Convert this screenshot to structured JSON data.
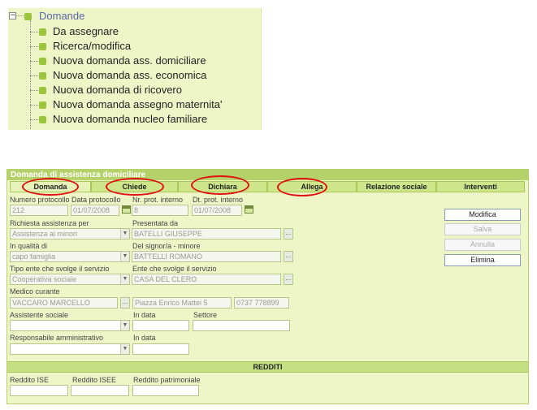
{
  "tree": {
    "toggle": "−",
    "root_label": "Domande",
    "items": [
      {
        "label": "Da assegnare"
      },
      {
        "label": "Ricerca/modifica"
      },
      {
        "label": "Nuova domanda ass. domiciliare"
      },
      {
        "label": "Nuova domanda ass. economica"
      },
      {
        "label": "Nuova domanda di ricovero"
      },
      {
        "label": "Nuova domanda assegno maternita'"
      },
      {
        "label": "Nuova domanda nucleo familiare"
      }
    ]
  },
  "form": {
    "title": "Domanda di assistenza domiciliare",
    "tabs": [
      {
        "label": "Domanda",
        "active": true,
        "highlighted": true
      },
      {
        "label": "Chiede",
        "highlighted": true
      },
      {
        "label": "Dichiara",
        "highlighted": true
      },
      {
        "label": "Allega",
        "highlighted": true
      },
      {
        "label": "Relazione sociale"
      },
      {
        "label": "Interventi"
      }
    ],
    "highlight_color": "#e01010",
    "fields": {
      "numero_protocollo": {
        "label": "Numero protocollo",
        "value": "212"
      },
      "data_protocollo": {
        "label": "Data protocollo",
        "value": "01/07/2008"
      },
      "nr_prot_interno": {
        "label": "Nr. prot. interno",
        "value": "8"
      },
      "dt_prot_interno": {
        "label": "Dt. prot. interno",
        "value": "01/07/2008"
      },
      "richiesta_assistenza": {
        "label": "Richiesta assistenza per",
        "value": "Assistenza ai minori"
      },
      "presentata_da": {
        "label": "Presentata da",
        "value": "BATELLI GIUSEPPE"
      },
      "in_qualita_di": {
        "label": "In qualità di",
        "value": "capo famiglia"
      },
      "del_signor": {
        "label": "Del signor/a - minore",
        "value": "BATTELLI ROMANO"
      },
      "tipo_ente": {
        "label": "Tipo ente che svolge il servizio",
        "value": "Cooperativa sociale"
      },
      "ente": {
        "label": "Ente che svolge il servizio",
        "value": "CASA DEL CLERO"
      },
      "medico_curante": {
        "label": "Medico curante",
        "value": "VACCARO MARCELLO",
        "address": "Piazza Enrico Mattei 5",
        "phone": "0737 778899"
      },
      "assistente_sociale": {
        "label": "Assistente sociale",
        "value": ""
      },
      "in_data_1": {
        "label": "In data",
        "value": ""
      },
      "settore": {
        "label": "Settore",
        "value": ""
      },
      "responsabile": {
        "label": "Responsabile amministrativo",
        "value": ""
      },
      "in_data_2": {
        "label": "In data",
        "value": ""
      }
    },
    "dots": "...",
    "select_arrow": "▼",
    "buttons": {
      "modifica": "Modifica",
      "salva": "Salva",
      "annulla": "Annulla",
      "elimina": "Elimina"
    },
    "redditi": {
      "title": "REDDITI",
      "reddito_ise": {
        "label": "Reddito ISE",
        "value": ""
      },
      "reddito_isee": {
        "label": "Reddito ISEE",
        "value": ""
      },
      "reddito_patrimoniale": {
        "label": "Reddito patrimoniale",
        "value": ""
      }
    }
  },
  "colors": {
    "panel_bg": "#eef6c8",
    "accent_green": "#b5d26a",
    "bullet_green": "#9bc53d",
    "root_label": "#5a64a8"
  }
}
